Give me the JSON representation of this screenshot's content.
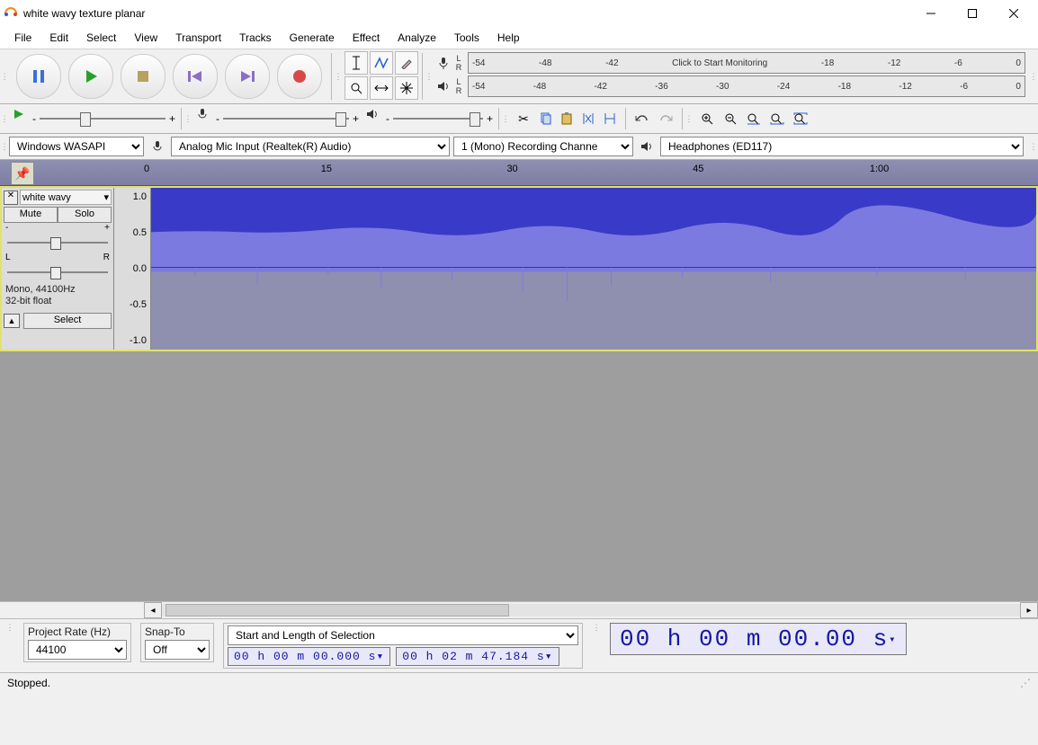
{
  "window": {
    "title": "white wavy texture planar"
  },
  "menu": [
    "File",
    "Edit",
    "Select",
    "View",
    "Transport",
    "Tracks",
    "Generate",
    "Effect",
    "Analyze",
    "Tools",
    "Help"
  ],
  "transport_icons": [
    "pause-icon",
    "play-icon",
    "stop-icon",
    "skip-start-icon",
    "skip-end-icon",
    "record-icon"
  ],
  "tool_grid": [
    "ibeam-icon",
    "envelope-icon",
    "draw-icon",
    "zoom-icon",
    "timeshift-icon",
    "multi-icon"
  ],
  "rec_meter": {
    "L": "L",
    "R": "R",
    "ticks": [
      "-54",
      "-48",
      "-42",
      "Click to Start Monitoring",
      "-18",
      "-12",
      "-6",
      "0"
    ]
  },
  "play_meter": {
    "L": "L",
    "R": "R",
    "ticks": [
      "-54",
      "-48",
      "-42",
      "-36",
      "-30",
      "-24",
      "-18",
      "-12",
      "-6",
      "0"
    ]
  },
  "device_bar": {
    "host": "Windows WASAPI",
    "rec_device": "Analog Mic Input (Realtek(R) Audio)",
    "rec_channels": "1 (Mono) Recording Channe",
    "play_device": "Headphones (ED117)"
  },
  "play_slider": {
    "min": "-",
    "max": "+"
  },
  "rec_slider": {
    "min": "-",
    "max": "+"
  },
  "edit_icons": [
    "cut-icon",
    "copy-icon",
    "paste-icon",
    "trim-icon",
    "silence-icon",
    "undo-icon",
    "redo-icon",
    "zoom-in-icon",
    "zoom-out-icon",
    "fit-selection-icon",
    "fit-project-icon",
    "zoom-toggle-icon"
  ],
  "timeline_labels": [
    "0",
    "15",
    "30",
    "45",
    "1:00"
  ],
  "track": {
    "name": "white wavy",
    "mute": "Mute",
    "solo": "Solo",
    "gain_ends": {
      "min": "-",
      "max": "+"
    },
    "pan_ends": {
      "left": "L",
      "right": "R"
    },
    "info1": "Mono, 44100Hz",
    "info2": "32-bit float",
    "select": "Select",
    "scale": [
      "1.0",
      "0.5",
      "0.0",
      "-0.5",
      "-1.0"
    ]
  },
  "selection_bar": {
    "project_rate_label": "Project Rate (Hz)",
    "project_rate": "44100",
    "snap_label": "Snap-To",
    "snap": "Off",
    "mode_label": "Start and Length of Selection",
    "start": "00 h 00 m 00.000 s",
    "length": "00 h 02 m 47.184 s",
    "position": "00 h 00 m 00.00 s"
  },
  "status": "Stopped."
}
